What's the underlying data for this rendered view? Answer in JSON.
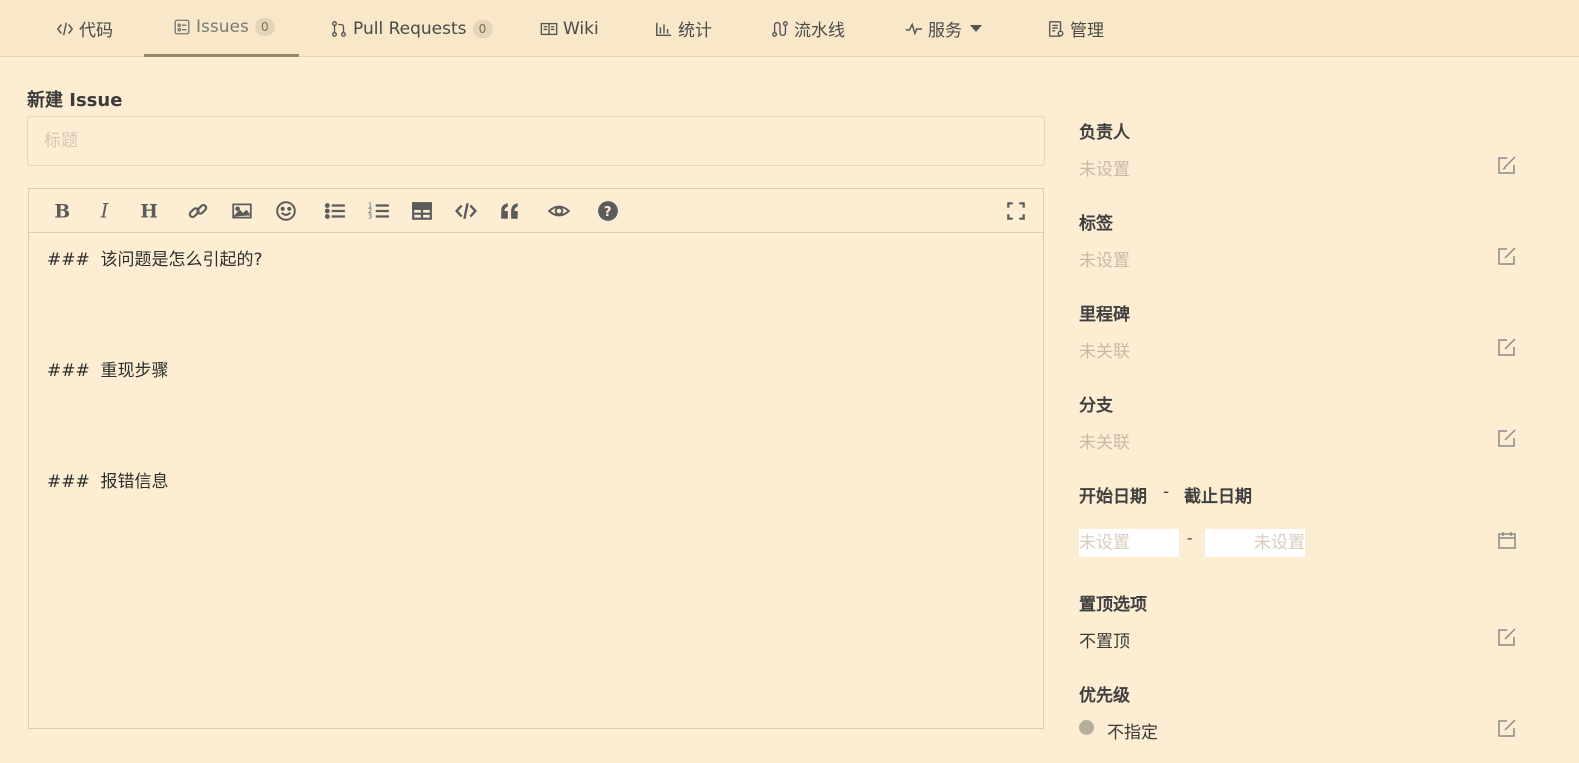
{
  "nav": {
    "tabs": [
      {
        "label": "代码",
        "icon": "code-icon"
      },
      {
        "label": "Issues",
        "icon": "issues-icon",
        "count": "0",
        "active": true
      },
      {
        "label": "Pull Requests",
        "icon": "pull-request-icon",
        "count": "0"
      },
      {
        "label": "Wiki",
        "icon": "book-icon"
      },
      {
        "label": "统计",
        "icon": "bar-chart-icon"
      },
      {
        "label": "流水线",
        "icon": "pipeline-icon"
      },
      {
        "label": "服务",
        "icon": "pulse-icon",
        "dropdown": true
      },
      {
        "label": "管理",
        "icon": "settings-doc-icon"
      }
    ]
  },
  "form": {
    "title": "新建 Issue",
    "title_placeholder": "标题"
  },
  "editor": {
    "toolbar": [
      "bold-icon",
      "italic-icon",
      "heading-icon",
      "link-icon",
      "image-icon",
      "emoji-icon",
      "bullet-list-icon",
      "numbered-list-icon",
      "table-icon",
      "code-icon",
      "quote-icon",
      "preview-icon",
      "help-icon",
      "fullscreen-icon"
    ],
    "lines": [
      "###  该问题是怎么引起的?",
      "###  重现步骤",
      "###  报错信息"
    ]
  },
  "sidebar": {
    "assignee": {
      "label": "负责人",
      "value": "未设置"
    },
    "labels": {
      "label": "标签",
      "value": "未设置"
    },
    "milestone": {
      "label": "里程碑",
      "value": "未关联"
    },
    "branch": {
      "label": "分支",
      "value": "未关联"
    },
    "dates": {
      "start_label": "开始日期",
      "separator": "-",
      "end_label": "截止日期",
      "start_placeholder": "未设置",
      "end_placeholder": "未设置",
      "range_separator": "-"
    },
    "pin": {
      "label": "置顶选项",
      "value": "不置顶"
    },
    "priority": {
      "label": "优先级",
      "value": "不指定"
    }
  },
  "colors": {
    "background": "#fdeed3",
    "nav_background": "#f8e7c9",
    "active_underline": "#9c8566"
  }
}
